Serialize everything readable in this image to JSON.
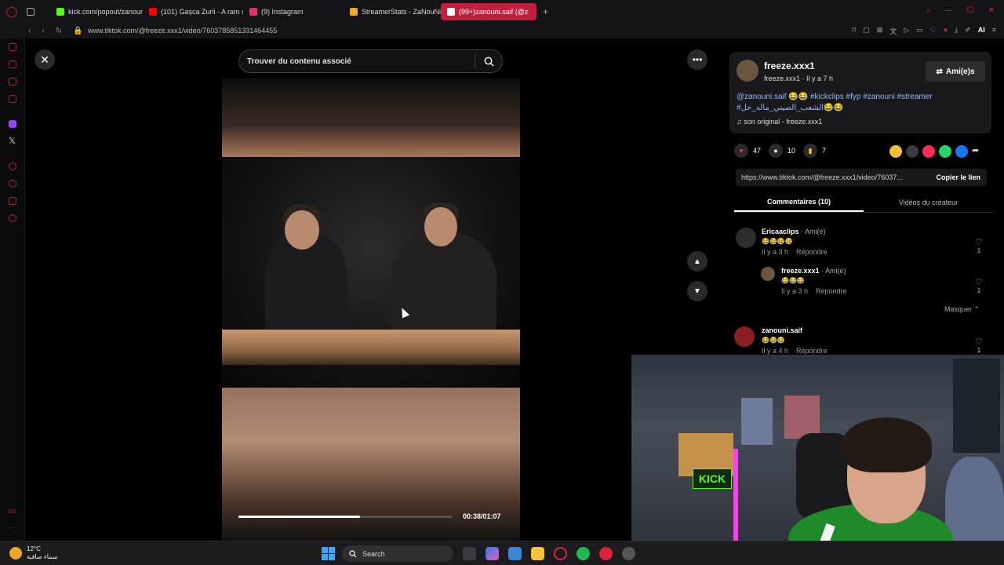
{
  "browser": {
    "tabs": [
      {
        "label": "kick.com/popout/zanouni",
        "icon_color": "#53fc18",
        "active": false
      },
      {
        "label": "(101) Gașca Zurli - A ram s",
        "icon_color": "#ff0000",
        "active": false
      },
      {
        "label": "(9) Instagram",
        "icon_color": "#e1306c",
        "active": false
      },
      {
        "label": "StreamerStats - ZaNouNi",
        "icon_color": "#f5a623",
        "active": false
      },
      {
        "label": "(99+)zanouni.saif (@z",
        "icon_color": "#ffffff",
        "active": true
      }
    ],
    "new_tab": "+",
    "url": "www.tiktok.com/@freeze.xxx1/video/7603785851331464455",
    "toolbar_ai": "AI"
  },
  "viewer": {
    "search_placeholder": "Trouver du contenu associé",
    "progress": 0.57,
    "timecode": "00:38/01:07"
  },
  "post": {
    "username": "freeze.xxx1",
    "meta": "freeze.xxx1 · Il y a 7 h",
    "friend_button": "Ami(e)s",
    "caption": "@zanouni.saif 😂😂 #kickclips #fyp #zanouni #streamer #الشعب_الصيني_ماله_حل😂😂",
    "music": "son original - freeze.xxx1",
    "likes": "47",
    "comments": "10",
    "saves": "7",
    "link": "https://www.tiktok.com/@freeze.xxx1/video/76037...",
    "copy_link": "Copier le lien",
    "tabs": [
      "Commentaires (10)",
      "Vidéos du créateur"
    ]
  },
  "comments": [
    {
      "user": "Ericaaclips",
      "tag": " · Ami(e)",
      "text": "😂😂😂😂",
      "time": "Il y a 3 h",
      "reply": "Répondre",
      "likes": "1"
    },
    {
      "user": "freeze.xxx1",
      "tag": " · Ami(e)",
      "text": "😂😂😂",
      "time": "Il y a 3 h",
      "reply": "Répondre",
      "likes": "1"
    },
    {
      "user": "zanouni.saif",
      "tag": "",
      "text": "😂😂😂",
      "time": "Il y a 4 h",
      "reply": "Répondre",
      "likes": "1"
    }
  ],
  "hide_replies": "Masquer",
  "taskbar": {
    "temperature": "12°C",
    "weather_text": "سماء صافية",
    "search_label": "Search"
  },
  "webcam": {
    "sign": "KICK"
  },
  "colors": {
    "accent": "#c0203e",
    "like": "#fe2c55",
    "save": "#f5c33b",
    "link_blue": "#8fb6f5"
  }
}
